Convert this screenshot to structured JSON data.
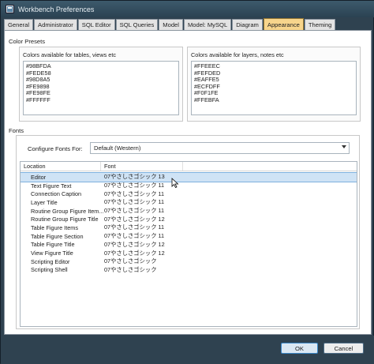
{
  "window": {
    "title": "Workbench Preferences"
  },
  "tabs": [
    {
      "label": "General"
    },
    {
      "label": "Administrator"
    },
    {
      "label": "SQL Editor"
    },
    {
      "label": "SQL Queries"
    },
    {
      "label": "Model"
    },
    {
      "label": "Model: MySQL"
    },
    {
      "label": "Diagram"
    },
    {
      "label": "Appearance",
      "active": true
    },
    {
      "label": "Theming"
    }
  ],
  "color_presets": {
    "section_label": "Color Presets",
    "tables_caption": "Colors available for tables, views etc",
    "tables_colors": [
      "#98BFDA",
      "#FEDE58",
      "#98D8A5",
      "#FE9898",
      "#FE98FE",
      "#FFFFFF"
    ],
    "layers_caption": "Colors available for layers, notes etc",
    "layers_colors": [
      "#FFEEEC",
      "#FEFDED",
      "#EAFFE5",
      "#ECFDFF",
      "#F0F1FE",
      "#FFEBFA"
    ]
  },
  "fonts": {
    "section_label": "Fonts",
    "configure_label": "Configure Fonts For:",
    "configure_value": "Default (Western)",
    "columns": {
      "location": "Location",
      "font": "Font"
    },
    "rows": [
      {
        "location": "Editor",
        "font": "07やさしさゴシック 13"
      },
      {
        "location": "Text Figure Text",
        "font": "07やさしさゴシック 11"
      },
      {
        "location": "Connection Caption",
        "font": "07やさしさゴシック 11"
      },
      {
        "location": "Layer Title",
        "font": "07やさしさゴシック 11"
      },
      {
        "location": "Routine Group Figure Item...",
        "font": "07やさしさゴシック 11"
      },
      {
        "location": "Routine Group Figure Title",
        "font": "07やさしさゴシック 12"
      },
      {
        "location": "Table Figure Items",
        "font": "07やさしさゴシック 11"
      },
      {
        "location": "Table Figure Section",
        "font": "07やさしさゴシック 11"
      },
      {
        "location": "Table Figure Title",
        "font": "07やさしさゴシック 12"
      },
      {
        "location": "View Figure Title",
        "font": "07やさしさゴシック 12"
      },
      {
        "location": "Scripting Editor",
        "font": "07やさしさゴシック"
      },
      {
        "location": "Scripting Shell",
        "font": "07やさしさゴシック"
      }
    ]
  },
  "buttons": {
    "ok": "OK",
    "cancel": "Cancel"
  },
  "colors": {
    "active_tab": "#f7d58c",
    "selected_row": "#cfe3f5",
    "chrome": "#2f4250"
  }
}
